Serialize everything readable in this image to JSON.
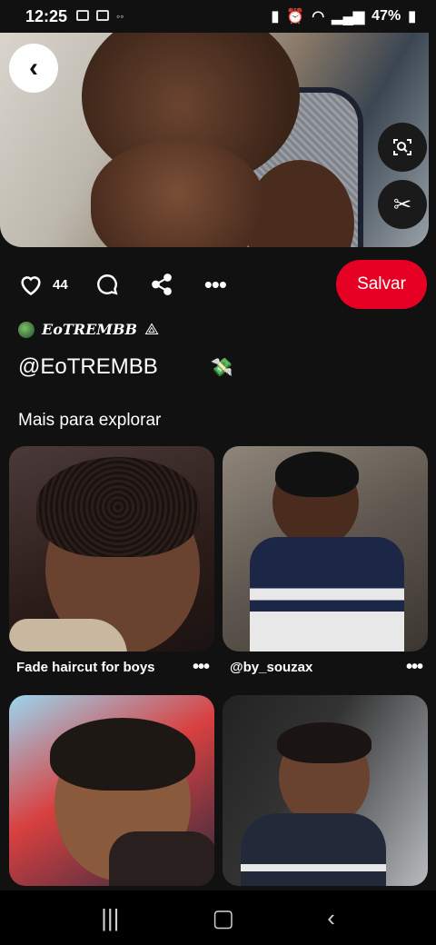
{
  "status_bar": {
    "time": "12:25",
    "battery": "47%"
  },
  "actions": {
    "like_count": "44",
    "save_label": "Salvar"
  },
  "profile": {
    "name": "EoTREMBB",
    "handle": "@EoTREMBB"
  },
  "section": {
    "title": "Mais para explorar"
  },
  "pins": [
    {
      "title": "Fade haircut for boys"
    },
    {
      "title": "@by_souzax"
    },
    {
      "title": ""
    },
    {
      "title": ""
    }
  ],
  "colors": {
    "save_button": "#e60023",
    "background": "#111111"
  }
}
